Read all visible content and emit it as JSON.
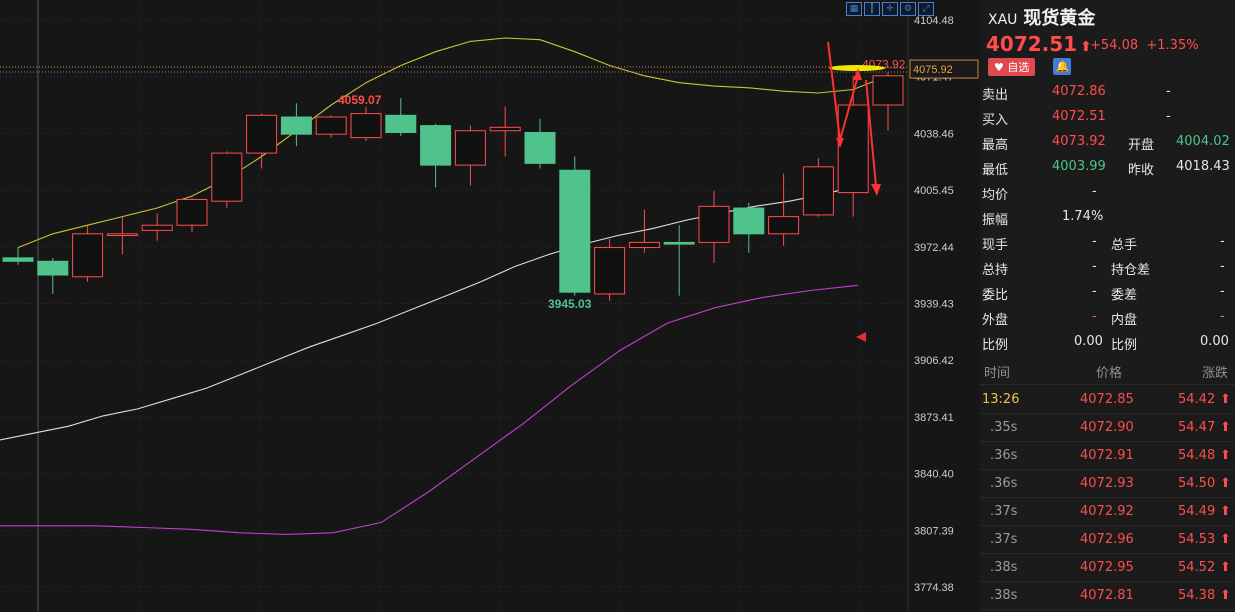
{
  "toolbar": {
    "icons": [
      "grid-icon",
      "candle-icon",
      "crosshair-icon",
      "settings-icon",
      "fullscreen-icon"
    ]
  },
  "chart_data": {
    "type": "candlestick",
    "y_axis": {
      "min": 3774.38,
      "max": 4104.48,
      "ticks": [
        "4104.48",
        "4071.47",
        "4038.46",
        "4005.45",
        "3972.44",
        "3939.43",
        "3906.42",
        "3873.41",
        "3840.40",
        "3807.39",
        "3774.38"
      ]
    },
    "candles": [
      {
        "o": 3966,
        "h": 3972,
        "l": 3962,
        "c": 3964
      },
      {
        "o": 3964,
        "h": 3966,
        "l": 3945,
        "c": 3956
      },
      {
        "o": 3955,
        "h": 3985,
        "l": 3952,
        "c": 3980
      },
      {
        "o": 3979,
        "h": 3990,
        "l": 3968,
        "c": 3980
      },
      {
        "o": 3982,
        "h": 3992,
        "l": 3976,
        "c": 3985
      },
      {
        "o": 3985,
        "h": 4001,
        "l": 3981,
        "c": 4000
      },
      {
        "o": 3999,
        "h": 4028,
        "l": 3995,
        "c": 4027
      },
      {
        "o": 4027,
        "h": 4050,
        "l": 4018,
        "c": 4049
      },
      {
        "o": 4048,
        "h": 4056,
        "l": 4031,
        "c": 4038
      },
      {
        "o": 4038,
        "h": 4049,
        "l": 4036,
        "c": 4048
      },
      {
        "o": 4036,
        "h": 4054,
        "l": 4034,
        "c": 4050
      },
      {
        "o": 4049,
        "h": 4059,
        "l": 4037,
        "c": 4039
      },
      {
        "o": 4043,
        "h": 4044,
        "l": 4007,
        "c": 4020
      },
      {
        "o": 4020,
        "h": 4043,
        "l": 4008,
        "c": 4040
      },
      {
        "o": 4040,
        "h": 4054,
        "l": 4025,
        "c": 4042
      },
      {
        "o": 4039,
        "h": 4047,
        "l": 4018,
        "c": 4021
      },
      {
        "o": 4017,
        "h": 4025,
        "l": 3944,
        "c": 3946
      },
      {
        "o": 3945,
        "h": 3977,
        "l": 3941,
        "c": 3972
      },
      {
        "o": 3972,
        "h": 3994,
        "l": 3969,
        "c": 3975
      },
      {
        "o": 3975,
        "h": 3985,
        "l": 3944,
        "c": 3974
      },
      {
        "o": 3975,
        "h": 4005,
        "l": 3963,
        "c": 3996
      },
      {
        "o": 3995,
        "h": 3998,
        "l": 3969,
        "c": 3980
      },
      {
        "o": 3980,
        "h": 4015,
        "l": 3973,
        "c": 3990
      },
      {
        "o": 3991,
        "h": 4024,
        "l": 3990,
        "c": 4019
      },
      {
        "o": 4004,
        "h": 4072,
        "l": 3990,
        "c": 4055
      },
      {
        "o": 4055,
        "h": 4074,
        "l": 4040,
        "c": 4072
      }
    ],
    "high_label": "4059.07",
    "low_label": "3945.03",
    "last_high_label": "4073.92",
    "current_price_tag": "4075.92",
    "ma_yellow": [
      3972,
      3980,
      3985,
      3990,
      3995,
      4002,
      4012,
      4025,
      4040,
      4055,
      4068,
      4078,
      4086,
      4092,
      4094,
      4093,
      4086,
      4078,
      4072,
      4068,
      4066,
      4065,
      4063,
      4062,
      4064,
      4072
    ],
    "ma_white": [
      3860,
      3864,
      3868,
      3874,
      3878,
      3884,
      3890,
      3898,
      3906,
      3914,
      3921,
      3928,
      3936,
      3944,
      3952,
      3961,
      3968,
      3974,
      3979,
      3983,
      3988,
      3992,
      3996,
      3999,
      4003,
      4008
    ],
    "ma_magenta": [
      3810,
      3810,
      3810,
      3809,
      3808,
      3806,
      3805,
      3806,
      3812,
      3830,
      3850,
      3870,
      3892,
      3912,
      3928,
      3937,
      3943,
      3947,
      3950
    ]
  },
  "quote": {
    "code": "XAU",
    "name": "现货黄金",
    "price": "4072.51",
    "change": "+54.08",
    "change_pct": "+1.35%",
    "fav_label": "自选",
    "sell_label": "卖出",
    "sell_value": "4072.86",
    "sell_vol": "-",
    "buy_label": "买入",
    "buy_value": "4072.51",
    "buy_vol": "-",
    "high_label": "最高",
    "high_value": "4073.92",
    "open_label": "开盘",
    "open_value": "4004.02",
    "low_label": "最低",
    "low_value": "4003.99",
    "prev_label": "昨收",
    "prev_value": "4018.43",
    "avg_label": "均价",
    "avg_value": "-",
    "amp_label": "振幅",
    "amp_value": "1.74%",
    "cur_vol_label": "现手",
    "cur_vol_value": "-",
    "total_vol_label": "总手",
    "total_vol_value": "-",
    "oi_label": "总持",
    "oi_value": "-",
    "oi_diff_label": "持仓差",
    "oi_diff_value": "-",
    "bid_ratio_label": "委比",
    "bid_ratio_value": "-",
    "bid_diff_label": "委差",
    "bid_diff_value": "-",
    "outer_label": "外盘",
    "outer_value": "-",
    "inner_label": "内盘",
    "inner_value": "-",
    "ratio1_label": "比例",
    "ratio1_value": "0.00",
    "ratio2_label": "比例",
    "ratio2_value": "0.00"
  },
  "ticks_header": {
    "time": "时间",
    "price": "价格",
    "change": "涨跌"
  },
  "ticks": [
    {
      "time": "13:26",
      "price": "4072.85",
      "change": "54.42"
    },
    {
      "time": ".35s",
      "price": "4072.90",
      "change": "54.47"
    },
    {
      "time": ".36s",
      "price": "4072.91",
      "change": "54.48"
    },
    {
      "time": ".36s",
      "price": "4072.93",
      "change": "54.50"
    },
    {
      "time": ".37s",
      "price": "4072.92",
      "change": "54.49"
    },
    {
      "time": ".37s",
      "price": "4072.96",
      "change": "54.53"
    },
    {
      "time": ".38s",
      "price": "4072.95",
      "change": "54.52"
    },
    {
      "time": ".38s",
      "price": "4072.81",
      "change": "54.38"
    }
  ],
  "colors": {
    "up": "#ff4d4d",
    "down": "#4fc38b",
    "ma_yellow": "#c9c33a",
    "ma_white": "#dedede",
    "ma_magenta": "#c23fd0"
  }
}
